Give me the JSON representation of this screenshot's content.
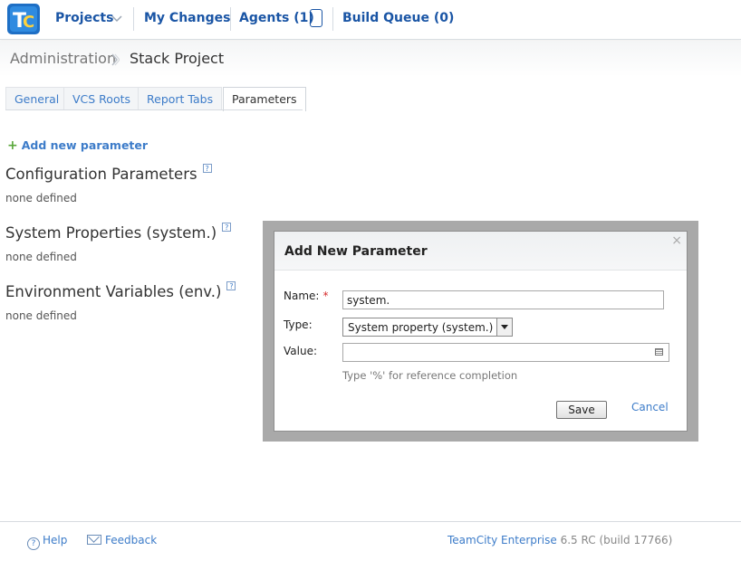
{
  "nav": {
    "projects": "Projects",
    "my_changes": "My Changes",
    "agents": "Agents (1)",
    "build_queue": "Build Queue (0)"
  },
  "breadcrumb": {
    "parent": "Administration",
    "current": "Stack Project"
  },
  "tabs": [
    "General",
    "VCS Roots",
    "Report Tabs",
    "Parameters"
  ],
  "active_tab": "Parameters",
  "add_param": "Add new parameter",
  "sections": [
    {
      "title": "Configuration Parameters",
      "status": "none defined"
    },
    {
      "title": "System Properties (system.)",
      "status": "none defined"
    },
    {
      "title": "Environment Variables (env.)",
      "status": "none defined"
    }
  ],
  "dialog": {
    "title": "Add New Parameter",
    "close": "×",
    "name_label": "Name:",
    "required_mark": "*",
    "name_value": "system.",
    "type_label": "Type:",
    "type_value": "System property (system.)",
    "value_label": "Value:",
    "hint": "Type '%' for reference completion",
    "save": "Save",
    "cancel": "Cancel"
  },
  "footer": {
    "help": "Help",
    "feedback": "Feedback",
    "product": "TeamCity Enterprise",
    "version": "6.5 RC (build 17766)"
  },
  "colors": {
    "link": "#3d7cc9",
    "nav": "#1a55a5",
    "required": "#d62b2b"
  }
}
